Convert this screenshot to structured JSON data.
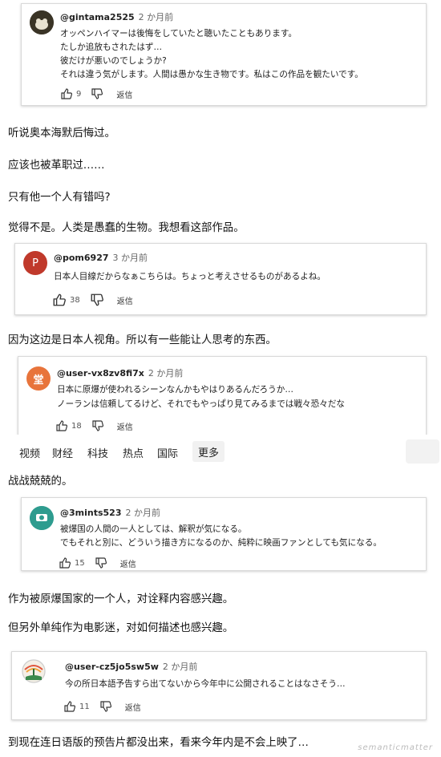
{
  "comments": [
    {
      "handle": "@gintama2525",
      "time": "2 か月前",
      "lines": [
        "オッペンハイマーは後悔をしていたと聴いたこともあります。",
        "たしか追放もされたはず…",
        "彼だけが悪いのでしょうか?",
        "それは違う気がします。人間は愚かな生き物です。私はこの作品を観たいです。"
      ],
      "likes": "9",
      "reply": "返信"
    },
    {
      "handle": "@pom6927",
      "time": "3 か月前",
      "avatar_letter": "P",
      "lines": [
        "日本人目線だからなぁこちらは。ちょっと考えさせるものがあるよね。"
      ],
      "likes": "38",
      "reply": "返信"
    },
    {
      "handle": "@user-vx8zv8fi7x",
      "time": "2 か月前",
      "avatar_letter": "堂",
      "lines": [
        "日本に原爆が使われるシーンなんかもやはりあるんだろうか…",
        "ノーランは信頼してるけど、それでもやっぱり見てみるまでは戦々恐々だな"
      ],
      "likes": "18",
      "reply": "返信"
    },
    {
      "handle": "@3mints523",
      "time": "2 か月前",
      "lines": [
        "被爆国の人間の一人としては、解釈が気になる。",
        "でもそれと別に、どういう描き方になるのか、純粋に映画ファンとしても気になる。"
      ],
      "likes": "15",
      "reply": "返信"
    },
    {
      "handle": "@user-cz5jo5sw5w",
      "time": "2 か月前",
      "lines": [
        "今の所日本語予告すら出てないから今年中に公開されることはなさそう…"
      ],
      "likes": "11",
      "reply": "返信"
    }
  ],
  "notes": [
    "听说奥本海默后悔过。",
    "应该也被革职过……",
    "只有他一个人有错吗?",
    "觉得不是。人类是愚蠢的生物。我想看这部作品。",
    "因为这边是日本人视角。所以有一些能让人思考的东西。",
    "战战兢兢的。",
    "作为被原爆国家的一个人，对诠释内容感兴趣。",
    "但另外单纯作为电影迷，对如何描述也感兴趣。",
    "到现在连日语版的预告片都没出来，看来今年内是不会上映了…"
  ],
  "nav": {
    "items": [
      "视频",
      "财经",
      "科技",
      "热点",
      "国际"
    ],
    "more": "更多"
  },
  "watermark": "semanticmatter",
  "colors": {
    "avatar_pom": "#c0392b",
    "avatar_user_vx": "#e8743b",
    "avatar_3mints": "#2e9c8f",
    "avatar_cz5": "#f1f1f1"
  }
}
